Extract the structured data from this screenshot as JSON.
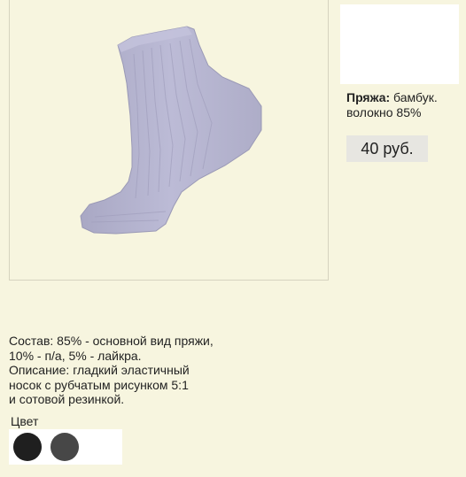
{
  "product": {
    "yarn_label": "Пряжа:",
    "yarn_value": "бамбук. волокно 85%",
    "price": "40 руб."
  },
  "description": {
    "lines": [
      "Состав: 85% - основной вид пряжи,",
      "10% - п/а, 5% - лайкра.",
      "Описание: гладкий эластичный",
      "носок с рубчатым рисунком 5:1",
      "и сотовой резинкой."
    ]
  },
  "colors": {
    "label": "Цвет",
    "swatches": [
      {
        "name": "black",
        "hex": "#1f1f1f"
      },
      {
        "name": "dark-gray",
        "hex": "#474747"
      },
      {
        "name": "white",
        "hex": "#ffffff"
      }
    ]
  },
  "theme": {
    "background": "#f7f5df",
    "sock_color": "#b9b8d2",
    "price_bg": "#e7e6e1"
  }
}
